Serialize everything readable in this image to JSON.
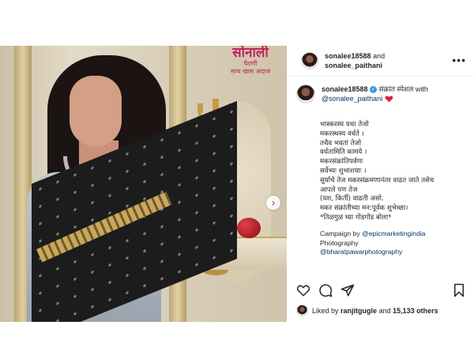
{
  "photo": {
    "brand_title": "सोनाली",
    "brand_sub": "पैठणी",
    "brand_tag": "साथ खास अंदाज"
  },
  "header": {
    "username": "sonalee18588",
    "joiner": "and",
    "collaborator": "sonalee_paithani"
  },
  "caption": {
    "username": "sonalee18588",
    "headline": "संक्रांत स्पेशल with",
    "mention": "@sonalee_paithani",
    "poem": "भास्करस्य यथा तेजो\nमकरस्थस्य वर्धते ।\nतथैव भवतां तेजो\nवर्धतामिति कामये ।\nमकरसंक्रांतिपर्वणः\nसर्वेभ्यः शुभाशयाः ।\nसुर्याचे तेज मकरसंक्रमणानंतर वाढत जाते तसेच\nआपले पण तेज\n(यश, किर्ती) वाढती असो.\nमकर संक्रांतीच्या मन:पूर्वक शुभेच्छा।\n*तिळगुळ घ्या गोडगोड बोला*",
    "credit_campaign_label": "Campaign by",
    "credit_campaign_handle": "@epicmarketingindia",
    "credit_photo_label": "Photography",
    "credit_photo_handle": "@bharatpawarphotography"
  },
  "likes": {
    "prefix": "Liked by",
    "user": "ranjitgugle",
    "joiner": "and",
    "others": "15,133 others"
  },
  "colors": {
    "verified": "#3897f0",
    "link": "#00376b",
    "brand": "#c21f56"
  }
}
